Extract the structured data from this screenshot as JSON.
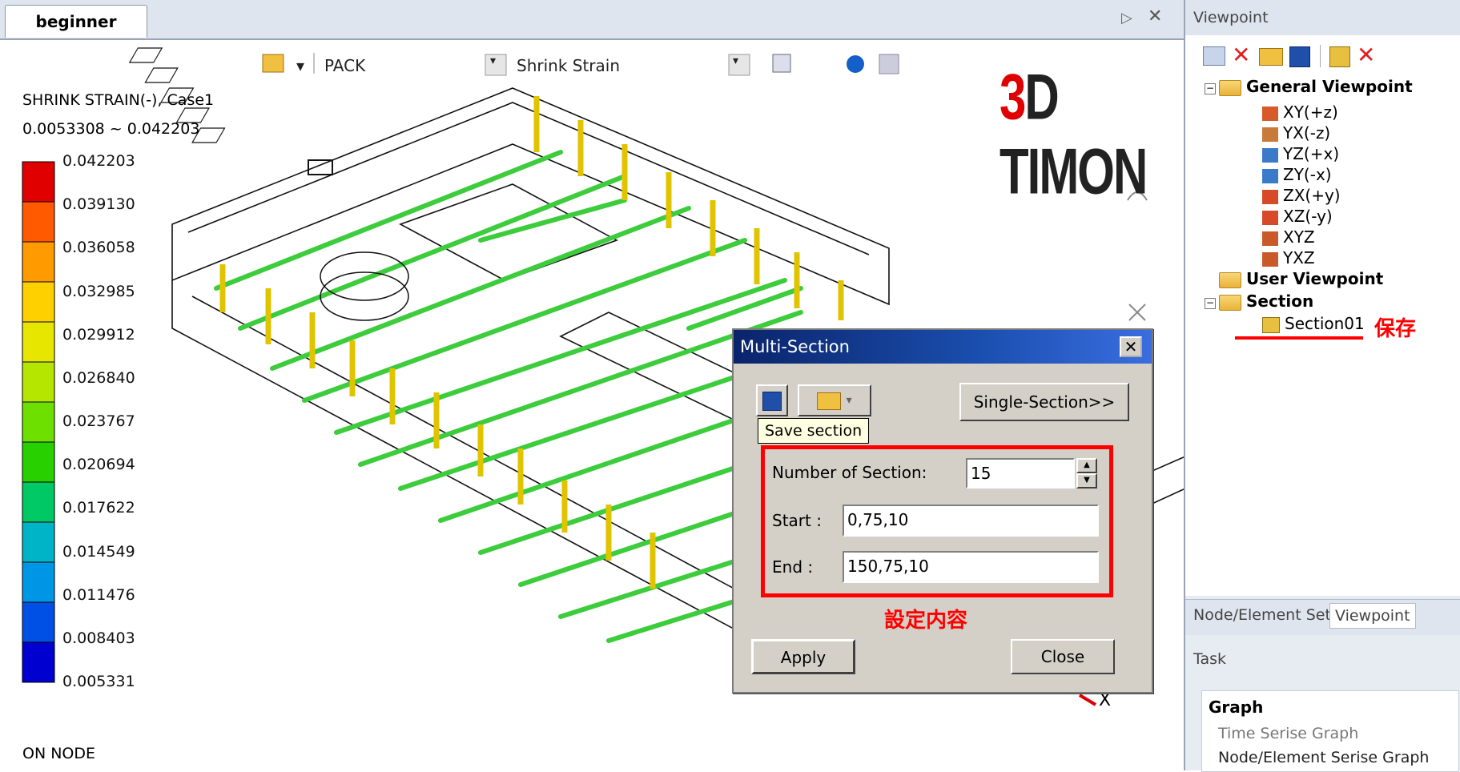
{
  "tab": {
    "title": "beginner",
    "arrow": "▷",
    "close": "✕"
  },
  "toolbar": {
    "pack_label": "PACK",
    "result_label": "Shrink Strain"
  },
  "logo": {
    "three": "3",
    "rest": "D TIMON"
  },
  "legend": {
    "title": "SHRINK STRAIN(-), Case1",
    "range": "0.0053308 ~ 0.042203",
    "values": [
      "0.042203",
      "0.039130",
      "0.036058",
      "0.032985",
      "0.029912",
      "0.026840",
      "0.023767",
      "0.020694",
      "0.017622",
      "0.014549",
      "0.011476",
      "0.008403",
      "0.005331"
    ],
    "colors": [
      "#e00000",
      "#ff5a00",
      "#ff9a00",
      "#ffd000",
      "#e6e600",
      "#b4e600",
      "#6ee000",
      "#28d000",
      "#00c864",
      "#00b4c8",
      "#0096e6",
      "#0050e6",
      "#0000d0"
    ],
    "footer": "ON NODE"
  },
  "axis_label": "X",
  "viewpoint_panel": {
    "header": "Viewpoint",
    "tree": {
      "general": "General Viewpoint",
      "items": [
        "XY(+z)",
        "YX(-z)",
        "YZ(+x)",
        "ZY(-x)",
        "ZX(+y)",
        "XZ(-y)",
        "XYZ",
        "YXZ"
      ],
      "user": "User Viewpoint",
      "section": "Section",
      "section_item": "Section01"
    },
    "save_note": "保存"
  },
  "bottom_tabs": {
    "node_element_set": "Node/Element Set",
    "viewpoint": "Viewpoint"
  },
  "task": {
    "header": "Task",
    "graph_title": "Graph",
    "items": [
      "Time Serise Graph",
      "Node/Element Serise Graph"
    ]
  },
  "dialog": {
    "title": "Multi-Section",
    "single_section_button": "Single-Section>>",
    "tooltip": "Save section",
    "number_label": "Number of Section:",
    "number_value": "15",
    "start_label": "Start :",
    "start_value": "0,75,10",
    "end_label": "End :",
    "end_value": "150,75,10",
    "settings_note": "設定内容",
    "apply_label": "Apply",
    "close_label": "Close"
  }
}
